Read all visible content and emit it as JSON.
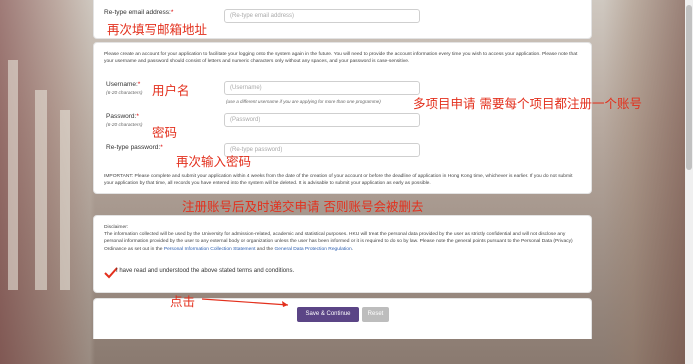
{
  "email_section": {
    "retype_email_label": "Re-type email address:",
    "retype_email_placeholder": "(Re-type email address)"
  },
  "account_section": {
    "intro": "Please create an account for your application to facilitate your logging onto the system again in the future. You will need to provide the account information every time you wish to access your application. Please note that your username and password should consist of letters and numeric characters only without any spaces, and your password is case-sensitive.",
    "username_label": "Username:",
    "username_hint": "(6-20 characters)",
    "username_placeholder": "(Username)",
    "username_note": "(use a different username if you are applying for more than one programme)",
    "password_label": "Password:",
    "password_hint": "(6-20 characters)",
    "password_placeholder": "(Password)",
    "retype_password_label": "Re-type password:",
    "retype_password_placeholder": "(Re-type password)",
    "important_1": "IMPORTANT: Please complete and submit your application within 4 weeks from the date of the creation of your account or before the deadline of application in Hong Kong time, whichever is earlier. If you do not submit your application by that time, all records you have entered into the system will be deleted. It is advisable to submit your application as early as possible."
  },
  "disclaimer": {
    "title": "Disclaimer:",
    "text": "The information collected will be used by the University for admission-related, academic and statistical purposes. HKU will treat the personal data provided by the user as strictly confidential and will not disclose any personal information provided by the user to any external body or organization unless the user has been informed or it is required to do so by law. Please note the general points pursuant to the Personal Data (Privacy) Ordinance as set out in the",
    "link1": "Personal Information Collection Statement",
    "and": "and the",
    "link2": "General Data Protection Regulation",
    "agree": "I have read and understood the above stated terms and conditions."
  },
  "buttons": {
    "save": "Save & Continue",
    "reset": "Reset"
  },
  "annotations": {
    "retype_email": "再次填写邮箱地址",
    "username": "用户名",
    "per_programme": "多项目申请 需要每个项目都注册一个账号",
    "password": "密码",
    "retype_password": "再次输入密码",
    "deadline": "注册账号后及时递交申请 否则账号会被删去",
    "click": "点击"
  },
  "colors": {
    "annotation": "#e3301d",
    "save_button": "#5b4586",
    "reset_button": "#bdbdbd"
  }
}
